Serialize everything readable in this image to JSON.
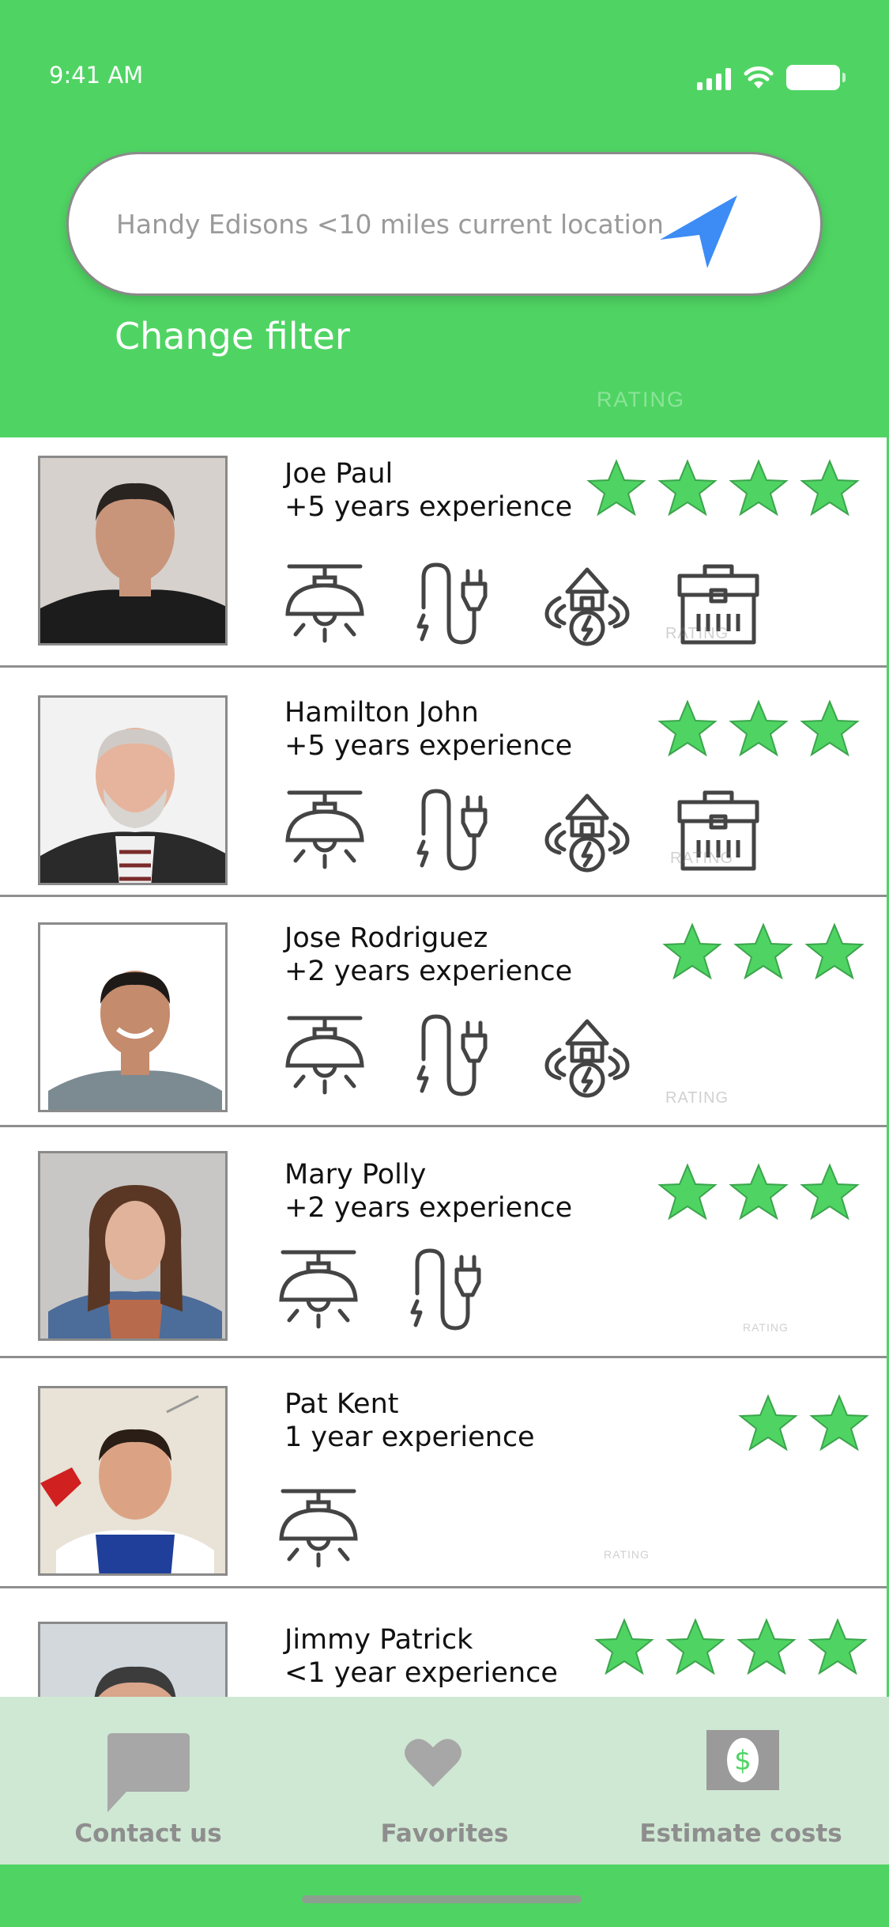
{
  "status_bar": {
    "time": "9:41 AM"
  },
  "search": {
    "text": "Handy Edisons <10 miles current location"
  },
  "filter": {
    "label": "Change filter"
  },
  "rating_label": "RATING",
  "colors": {
    "accent": "#4fd463",
    "star": "#4fd463",
    "icon": "#444444",
    "nav_arrow": "#3d8cf5"
  },
  "handymen": [
    {
      "name": "Joe Paul",
      "experience": "+5 years experience",
      "rating": 4,
      "services": [
        "ceiling-lamp-icon",
        "electric-plug-icon",
        "home-power-icon",
        "toolbox-icon"
      ]
    },
    {
      "name": "Hamilton John",
      "experience": "+5 years experience",
      "rating": 3,
      "services": [
        "ceiling-lamp-icon",
        "electric-plug-icon",
        "home-power-icon",
        "toolbox-icon"
      ]
    },
    {
      "name": "Jose Rodriguez",
      "experience": "+2 years experience",
      "rating": 3,
      "services": [
        "ceiling-lamp-icon",
        "electric-plug-icon",
        "home-power-icon"
      ]
    },
    {
      "name": "Mary Polly",
      "experience": "+2 years experience",
      "rating": 3,
      "services": [
        "ceiling-lamp-icon",
        "electric-plug-icon"
      ]
    },
    {
      "name": "Pat Kent",
      "experience": "1 year experience",
      "rating": 2,
      "services": [
        "ceiling-lamp-icon"
      ]
    },
    {
      "name": "Jimmy Patrick",
      "experience": "<1 year experience",
      "rating": 4,
      "services": []
    }
  ],
  "tabbar": {
    "contact": "Contact us",
    "favorites": "Favorites",
    "estimate": "Estimate costs"
  }
}
